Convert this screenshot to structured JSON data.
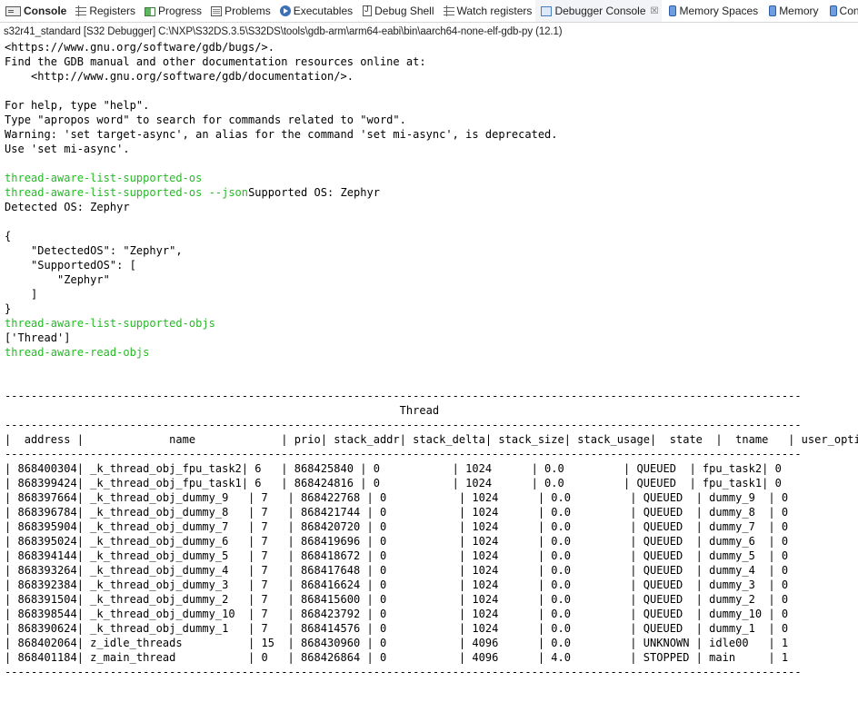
{
  "tabs": [
    {
      "label": "Console",
      "icon": "console-icon",
      "bold": true
    },
    {
      "label": "Registers",
      "icon": "registers-icon"
    },
    {
      "label": "Progress",
      "icon": "progress-icon"
    },
    {
      "label": "Problems",
      "icon": "problems-icon"
    },
    {
      "label": "Executables",
      "icon": "executables-icon"
    },
    {
      "label": "Debug Shell",
      "icon": "debug-shell-icon"
    },
    {
      "label": "Watch registers",
      "icon": "watch-registers-icon"
    },
    {
      "label": "Debugger Console",
      "icon": "debugger-console-icon",
      "active": true,
      "close": "☒"
    },
    {
      "label": "Memory Spaces",
      "icon": "memory-spaces-icon"
    },
    {
      "label": "Memory",
      "icon": "memory-icon"
    },
    {
      "label": "Control a",
      "icon": "control-icon"
    }
  ],
  "console_title": "s32r41_standard [S32 Debugger] C:\\NXP\\S32DS.3.5\\S32DS\\tools\\gdb-arm\\arm64-eabi\\bin\\aarch64-none-elf-gdb-py (12.1)",
  "colors": {
    "command": "#27b927",
    "text": "#000000"
  },
  "lines": [
    {
      "t": "<https://www.gnu.org/software/gdb/bugs/>."
    },
    {
      "t": "Find the GDB manual and other documentation resources online at:"
    },
    {
      "t": "    <http://www.gnu.org/software/gdb/documentation/>."
    },
    {
      "t": ""
    },
    {
      "t": "For help, type \"help\"."
    },
    {
      "t": "Type \"apropos word\" to search for commands related to \"word\"."
    },
    {
      "t": "Warning: 'set target-async', an alias for the command 'set mi-async', is deprecated."
    },
    {
      "t": "Use 'set mi-async'."
    },
    {
      "t": ""
    },
    {
      "c": "thread-aware-list-supported-os"
    },
    {
      "c": "thread-aware-list-supported-os --json",
      "t": "Supported OS: Zephyr"
    },
    {
      "t": "Detected OS: Zephyr"
    },
    {
      "t": ""
    },
    {
      "t": "{"
    },
    {
      "t": "    \"DetectedOS\": \"Zephyr\","
    },
    {
      "t": "    \"SupportedOS\": ["
    },
    {
      "t": "        \"Zephyr\""
    },
    {
      "t": "    ]"
    },
    {
      "t": "}"
    },
    {
      "c": "thread-aware-list-supported-objs"
    },
    {
      "t": "['Thread']"
    },
    {
      "c": "thread-aware-read-objs"
    },
    {
      "t": ""
    },
    {
      "t": ""
    },
    {
      "t": "-------------------------------------------------------------------------------------------------------------------------"
    },
    {
      "t": "                                                            Thread"
    },
    {
      "t": "-------------------------------------------------------------------------------------------------------------------------"
    },
    {
      "t": "|  address |             name             | prio| stack_addr| stack_delta| stack_size| stack_usage|  state  |  tname   | user_options|"
    },
    {
      "t": "-------------------------------------------------------------------------------------------------------------------------"
    },
    {
      "t": "| 868400304| _k_thread_obj_fpu_task2| 6   | 868425840 | 0           | 1024      | 0.0         | QUEUED  | fpu_task2| 0            |"
    },
    {
      "t": "| 868399424| _k_thread_obj_fpu_task1| 6   | 868424816 | 0           | 1024      | 0.0         | QUEUED  | fpu_task1| 0            |"
    },
    {
      "t": "| 868397664| _k_thread_obj_dummy_9   | 7   | 868422768 | 0           | 1024      | 0.0         | QUEUED  | dummy_9  | 0            |"
    },
    {
      "t": "| 868396784| _k_thread_obj_dummy_8   | 7   | 868421744 | 0           | 1024      | 0.0         | QUEUED  | dummy_8  | 0            |"
    },
    {
      "t": "| 868395904| _k_thread_obj_dummy_7   | 7   | 868420720 | 0           | 1024      | 0.0         | QUEUED  | dummy_7  | 0            |"
    },
    {
      "t": "| 868395024| _k_thread_obj_dummy_6   | 7   | 868419696 | 0           | 1024      | 0.0         | QUEUED  | dummy_6  | 0            |"
    },
    {
      "t": "| 868394144| _k_thread_obj_dummy_5   | 7   | 868418672 | 0           | 1024      | 0.0         | QUEUED  | dummy_5  | 0            |"
    },
    {
      "t": "| 868393264| _k_thread_obj_dummy_4   | 7   | 868417648 | 0           | 1024      | 0.0         | QUEUED  | dummy_4  | 0            |"
    },
    {
      "t": "| 868392384| _k_thread_obj_dummy_3   | 7   | 868416624 | 0           | 1024      | 0.0         | QUEUED  | dummy_3  | 0            |"
    },
    {
      "t": "| 868391504| _k_thread_obj_dummy_2   | 7   | 868415600 | 0           | 1024      | 0.0         | QUEUED  | dummy_2  | 0            |"
    },
    {
      "t": "| 868398544| _k_thread_obj_dummy_10  | 7   | 868423792 | 0           | 1024      | 0.0         | QUEUED  | dummy_10 | 0            |"
    },
    {
      "t": "| 868390624| _k_thread_obj_dummy_1   | 7   | 868414576 | 0           | 1024      | 0.0         | QUEUED  | dummy_1  | 0            |"
    },
    {
      "t": "| 868402064| z_idle_threads          | 15  | 868430960 | 0           | 4096      | 0.0         | UNKNOWN | idle00   | 1            |"
    },
    {
      "t": "| 868401184| z_main_thread           | 0   | 868426864 | 0           | 4096      | 4.0         | STOPPED | main     | 1            |"
    },
    {
      "t": "-------------------------------------------------------------------------------------------------------------------------"
    }
  ]
}
